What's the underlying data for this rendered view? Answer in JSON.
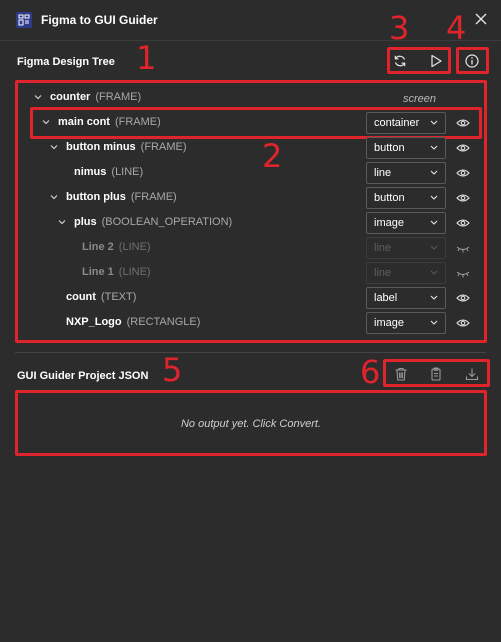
{
  "window": {
    "title": "Figma to GUI Guider"
  },
  "design_tree": {
    "title": "Figma Design Tree",
    "screen_label": "screen",
    "rows": [
      {
        "name": "counter",
        "type": "(FRAME)"
      },
      {
        "name": "main cont",
        "type": "(FRAME)",
        "select": "container"
      },
      {
        "name": "button minus",
        "type": "(FRAME)",
        "select": "button"
      },
      {
        "name": "nimus",
        "type": "(LINE)",
        "select": "line"
      },
      {
        "name": "button plus",
        "type": "(FRAME)",
        "select": "button"
      },
      {
        "name": "plus",
        "type": "(BOOLEAN_OPERATION)",
        "select": "image"
      },
      {
        "name": "Line 2",
        "type": "(LINE)",
        "select": "line",
        "disabled": true
      },
      {
        "name": "Line 1",
        "type": "(LINE)",
        "select": "line",
        "disabled": true
      },
      {
        "name": "count",
        "type": "(TEXT)",
        "select": "label"
      },
      {
        "name": "NXP_Logo",
        "type": "(RECTANGLE)",
        "select": "image"
      }
    ]
  },
  "json_panel": {
    "title": "GUI Guider Project JSON",
    "empty_message": "No output yet. Click Convert."
  },
  "annotations": [
    "1",
    "2",
    "3",
    "4",
    "5",
    "6"
  ],
  "colors": {
    "annotation": "#e0242c",
    "background": "#2c2c2c",
    "accent_icon": "#2f3a8a"
  },
  "icons": {
    "refresh": "refresh-icon",
    "convert": "play-icon",
    "info": "info-icon",
    "clear": "trash-icon",
    "copy": "clipboard-icon",
    "download": "download-icon",
    "visible": "eye-icon",
    "hidden": "eye-closed-icon",
    "close": "close-icon"
  }
}
